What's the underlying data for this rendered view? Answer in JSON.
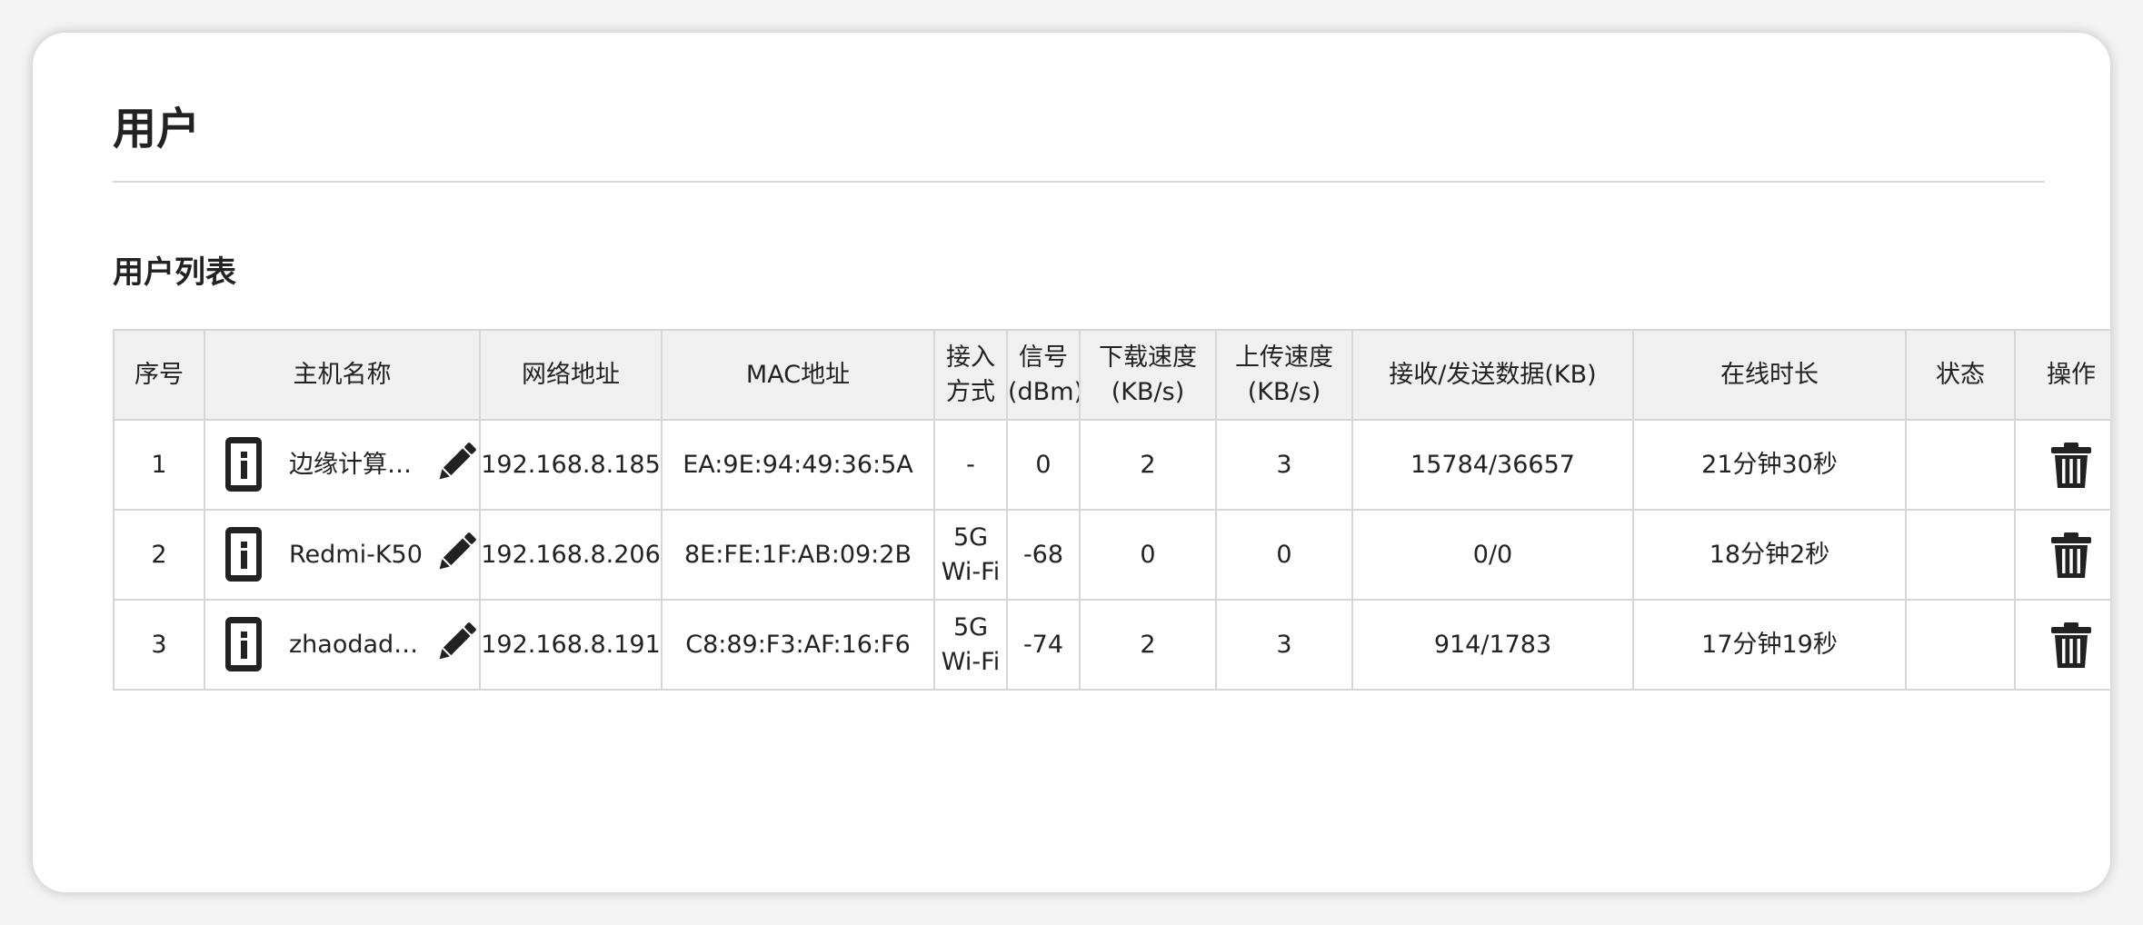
{
  "page": {
    "title": "用户"
  },
  "section": {
    "title": "用户列表"
  },
  "table": {
    "headers": {
      "index": "序号",
      "hostname": "主机名称",
      "ip": "网络地址",
      "mac": "MAC地址",
      "access_line1": "接入",
      "access_line2": "方式",
      "signal_line1": "信号",
      "signal_line2": "(dBm)",
      "down_line1": "下载速度",
      "down_line2": "(KB/s)",
      "up_line1": "上传速度",
      "up_line2": "(KB/s)",
      "data": "接收/发送数据(KB)",
      "online": "在线时长",
      "status": "状态",
      "action": "操作"
    },
    "rows": [
      {
        "index": "1",
        "hostname": "边缘计算…",
        "ip": "192.168.8.185",
        "mac": "EA:9E:94:49:36:5A",
        "access_line1": "-",
        "access_line2": "",
        "signal": "0",
        "down": "2",
        "up": "3",
        "data": "15784/36657",
        "online": "21分钟30秒",
        "status": ""
      },
      {
        "index": "2",
        "hostname": "Redmi-K50",
        "ip": "192.168.8.206",
        "mac": "8E:FE:1F:AB:09:2B",
        "access_line1": "5G",
        "access_line2": "Wi-Fi",
        "signal": "-68",
        "down": "0",
        "up": "0",
        "data": "0/0",
        "online": "18分钟2秒",
        "status": ""
      },
      {
        "index": "3",
        "hostname": "zhaodad…",
        "ip": "192.168.8.191",
        "mac": "C8:89:F3:AF:16:F6",
        "access_line1": "5G",
        "access_line2": "Wi-Fi",
        "signal": "-74",
        "down": "2",
        "up": "3",
        "data": "914/1783",
        "online": "17分钟19秒",
        "status": ""
      }
    ]
  },
  "icons": {
    "device": "device-info-icon",
    "edit": "pencil-icon",
    "delete": "trash-icon"
  },
  "colors": {
    "header_bg": "#f0f0f0",
    "border": "#d6d6d6",
    "text": "#222222"
  }
}
